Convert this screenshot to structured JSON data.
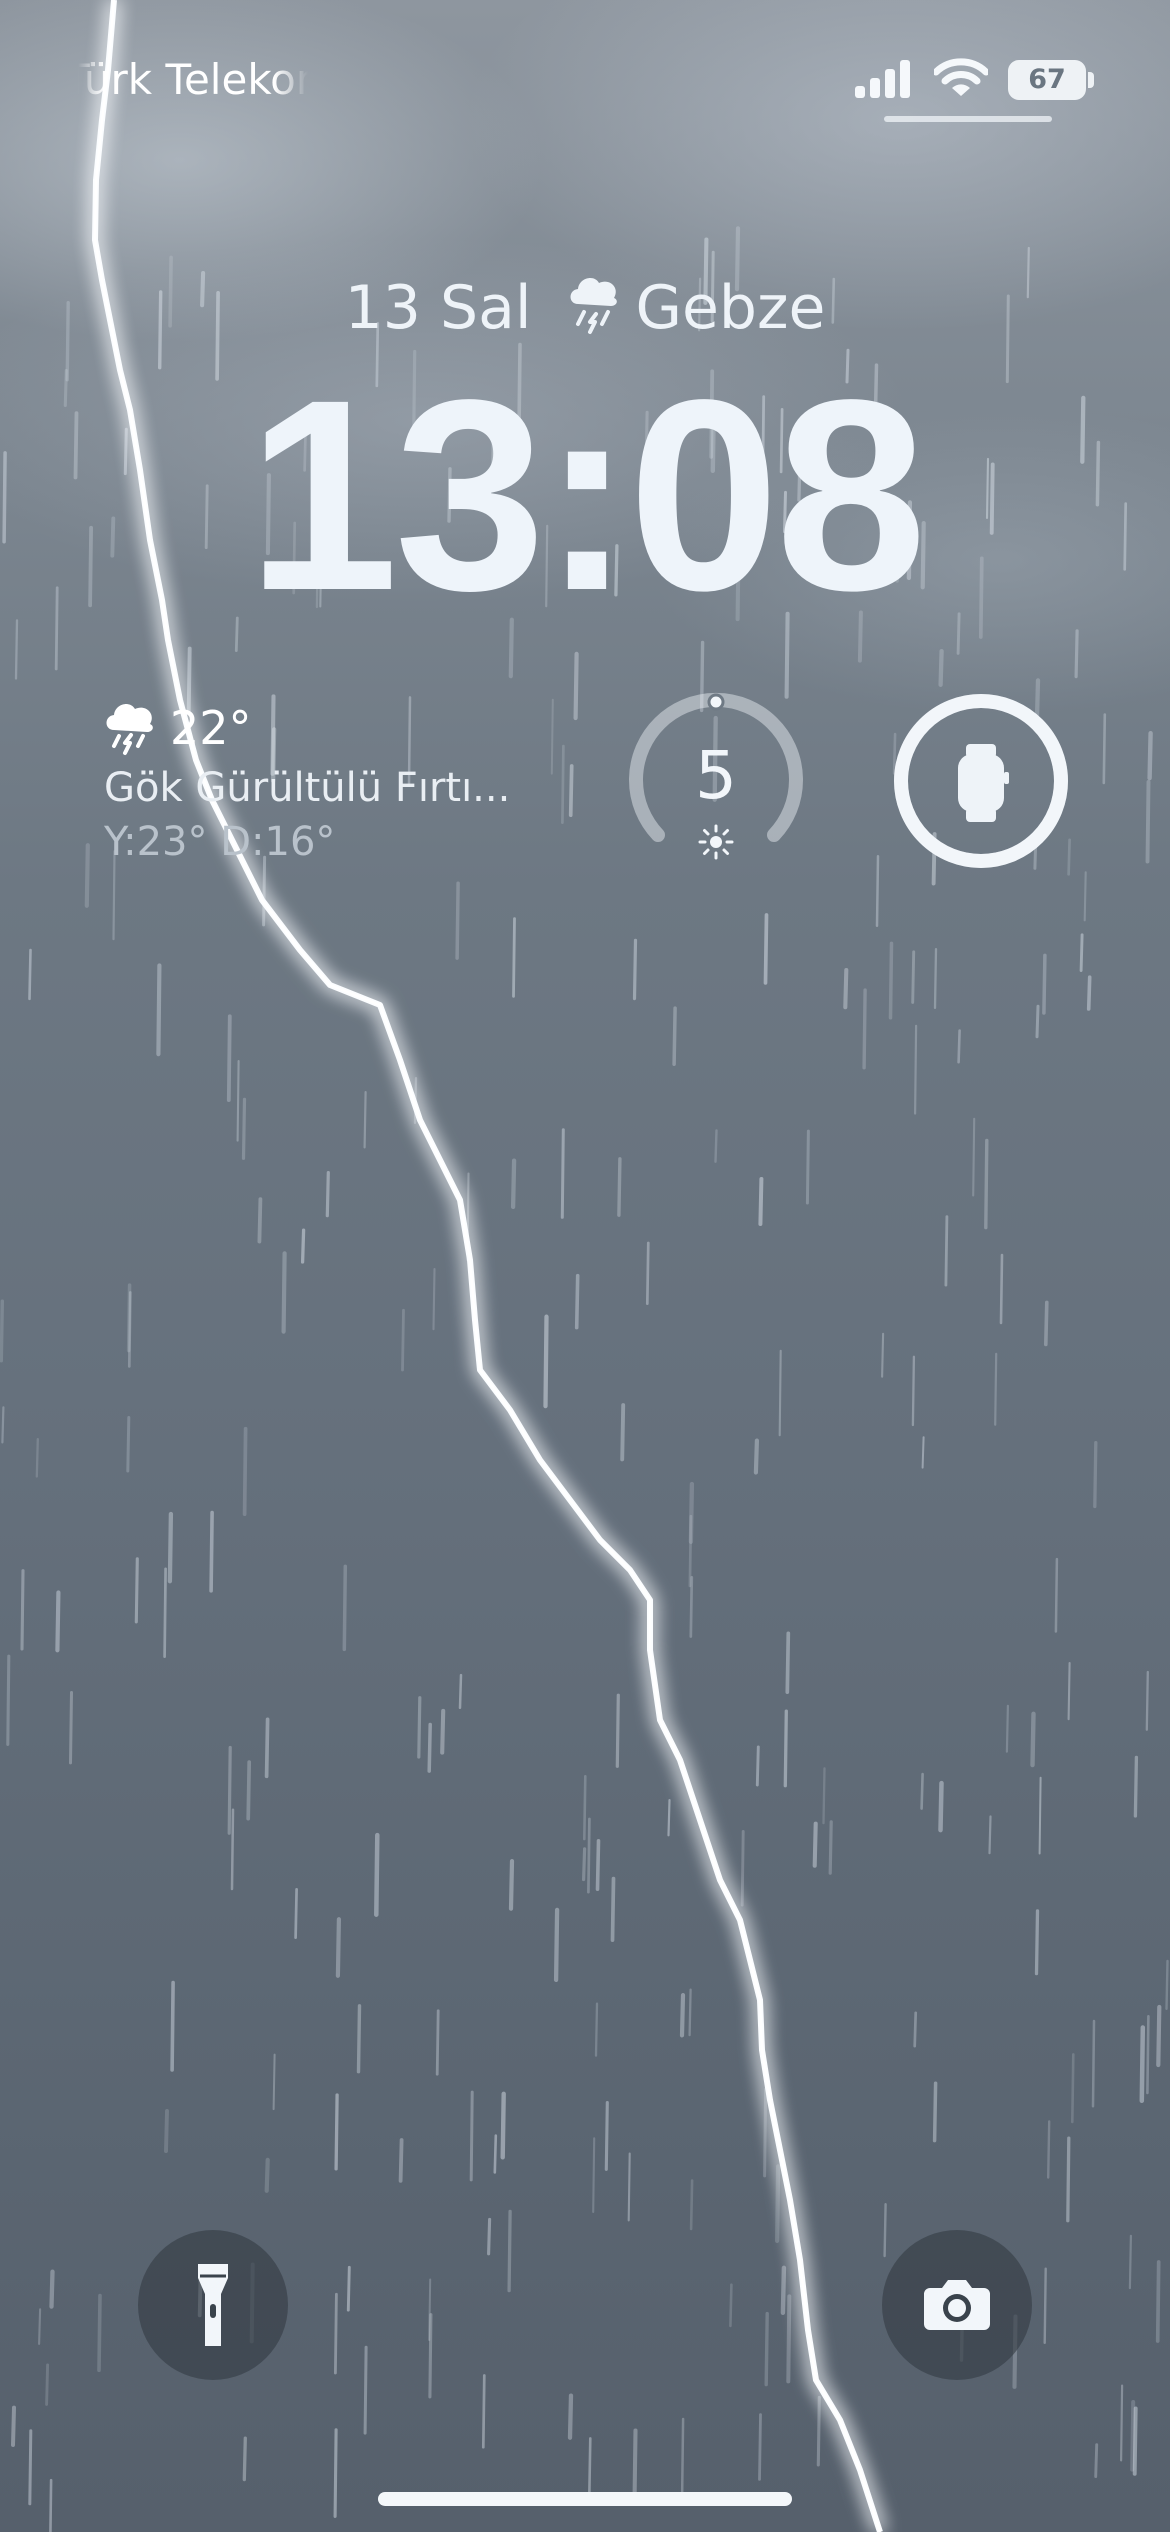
{
  "status_bar": {
    "carrier": "Türk Telekom",
    "battery_level": "67",
    "signal_icon": "cellular-signal-icon",
    "wifi_icon": "wifi-icon"
  },
  "lock_screen": {
    "date": "13 Sal",
    "location": "Gebze",
    "date_weather_icon": "thunderstorm-rain-icon",
    "time": "13:08"
  },
  "widgets": {
    "weather": {
      "icon": "thunderstorm-rain-icon",
      "temperature": "22°",
      "condition": "Gök Gürültülü Fırtı...",
      "high_low": "Y:23° D:16°"
    },
    "uv_index": {
      "value": "5",
      "icon": "sun-icon",
      "gauge_level": 0.5
    },
    "watch_battery": {
      "icon": "apple-watch-icon",
      "level": 1.0
    }
  },
  "quick_actions": {
    "flashlight_icon": "flashlight-icon",
    "camera_icon": "camera-icon"
  },
  "colors": {
    "sky_top": "#8e969f",
    "sky_bottom": "#56606c",
    "foreground": "#f2f6fa",
    "button_bg": "#343c44"
  }
}
